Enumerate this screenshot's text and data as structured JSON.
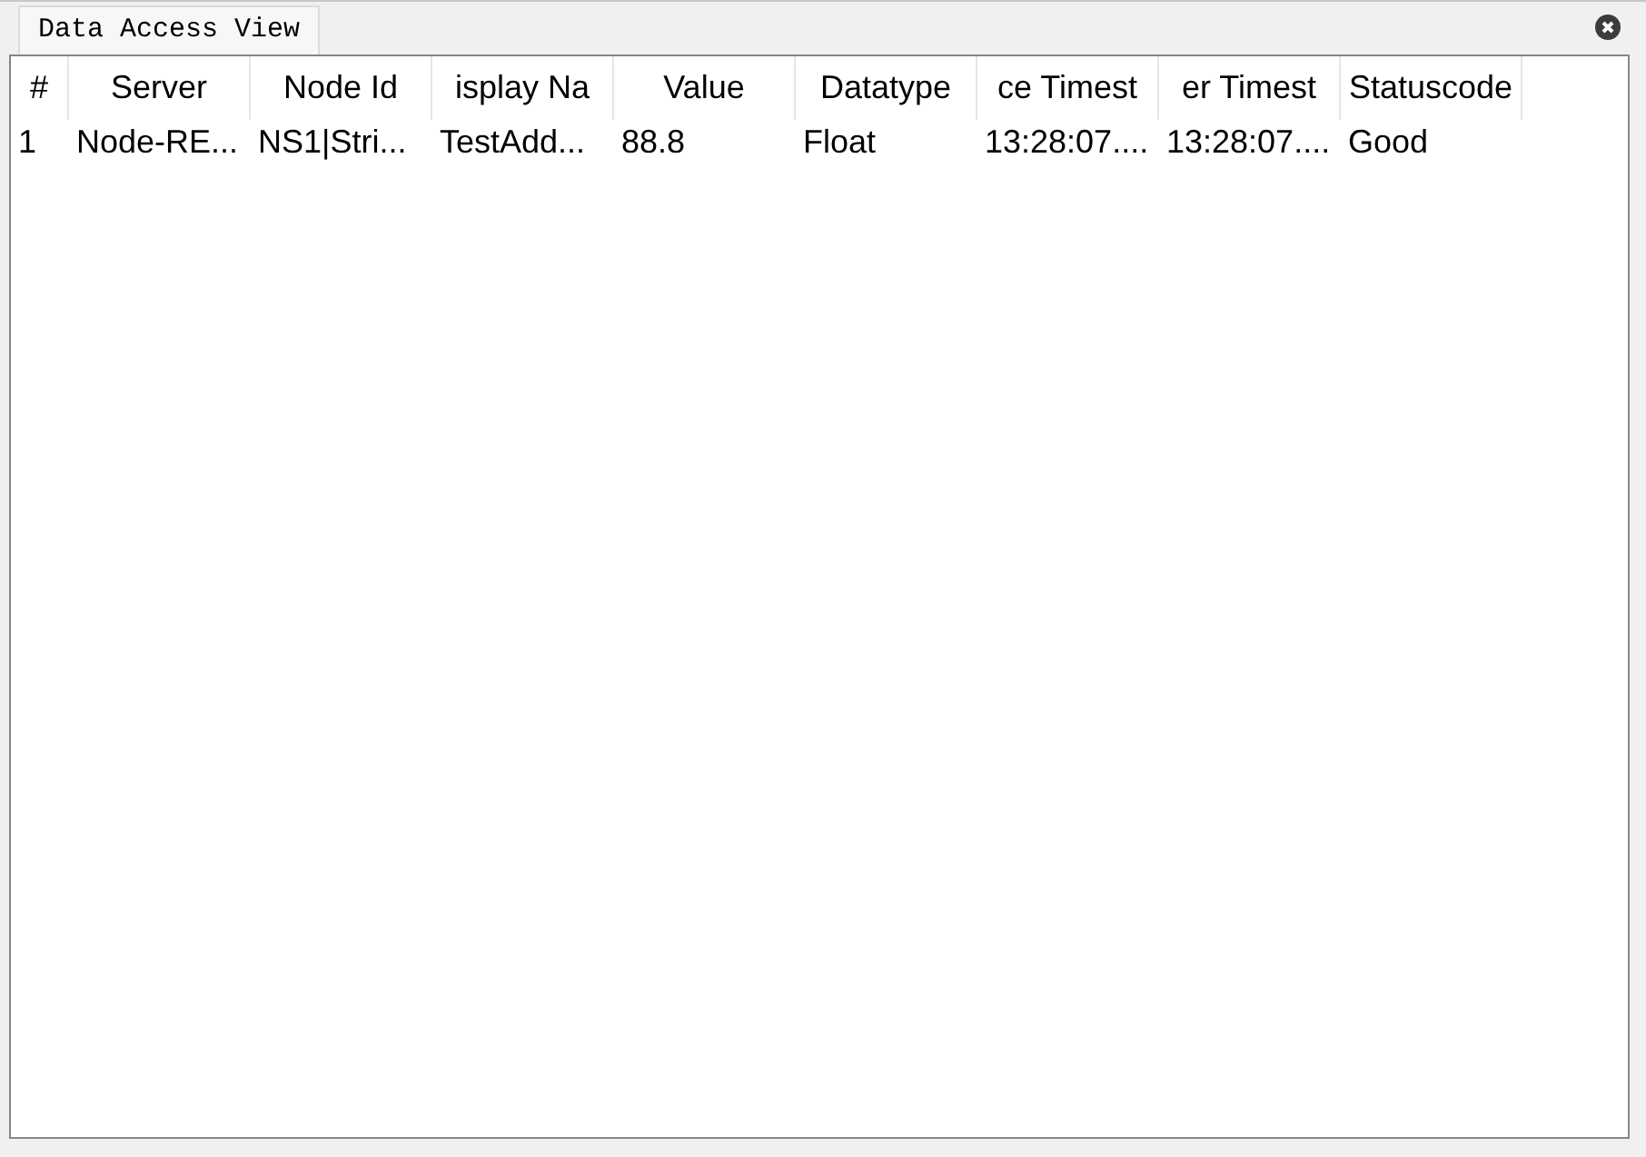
{
  "tabs": [
    {
      "label": "Data Access View",
      "selected": true
    }
  ],
  "table": {
    "columns": [
      "#",
      "Server",
      "Node Id",
      "isplay Na",
      "Value",
      "Datatype",
      "ce Timest",
      "er Timest",
      "Statuscode"
    ],
    "rows": [
      [
        "1",
        "Node-RE...",
        "NS1|Stri...",
        "TestAdd...",
        "88.8",
        "Float",
        "13:28:07....",
        "13:28:07....",
        "Good"
      ]
    ]
  }
}
